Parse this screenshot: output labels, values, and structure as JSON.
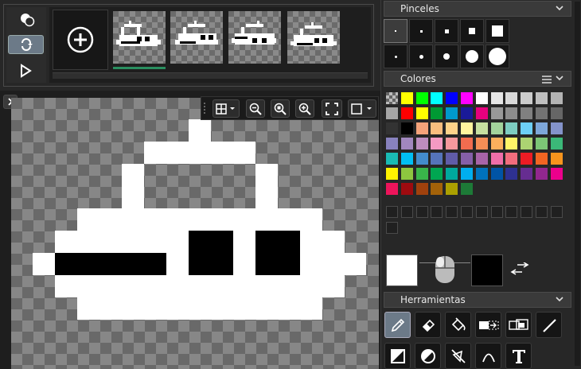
{
  "animation": {
    "add_frame_icon": "plus-circle-icon",
    "frames": [
      {
        "label": "frame-1",
        "selected": true
      },
      {
        "label": "frame-2",
        "selected": false
      },
      {
        "label": "frame-3",
        "selected": false
      },
      {
        "label": "frame-4",
        "selected": false
      }
    ]
  },
  "panels": {
    "brushes_title": "Pinceles",
    "colors_title": "Colores",
    "tools_title": "Herramientas"
  },
  "colors": {
    "primary": "#ffffff",
    "secondary": "#000000",
    "palette": [
      "#808080",
      "#ffff00",
      "#00ff00",
      "#00ffff",
      "#0000ff",
      "#ff00ff",
      "#ffffff",
      "#e6e6e6",
      "#d9d9d9",
      "#cccccc",
      "#bfbfbf",
      "#b3b3b3",
      "#a6a6a6",
      "#ff0000",
      "#ffff00",
      "#009933",
      "#0099cc",
      "#1a1a99",
      "#e6007e",
      "#999999",
      "#8c8c8c",
      "#808080",
      "#737373",
      "#666666",
      "#333333",
      "#000000",
      "#f5a37a",
      "#f9bd7e",
      "#fed38a",
      "#fff59e",
      "#c6e0a0",
      "#a3d39c",
      "#7ecdc2",
      "#6dcff6",
      "#7da7d9",
      "#8493ca",
      "#8882be",
      "#a187be",
      "#bc8dbf",
      "#f49ac2",
      "#f6989d",
      "#f26c4f",
      "#f68e56",
      "#fbaf5d",
      "#fff568",
      "#acd372",
      "#7cc576",
      "#3bb878",
      "#1abbb4",
      "#00bff3",
      "#438ccb",
      "#5574b9",
      "#605ca8",
      "#855fa8",
      "#a864a8",
      "#f06ea9",
      "#f26d7d",
      "#ed1c24",
      "#f26522",
      "#f7941d",
      "#fff200",
      "#8dc63f",
      "#39b54a",
      "#00a651",
      "#00a99d",
      "#00aeef",
      "#0072bc",
      "#0054a6",
      "#2e3192",
      "#662d91",
      "#92278f",
      "#ec008c",
      "#ed145b",
      "#9e0b0f",
      "#a0410d",
      "#a36209",
      "#aba000",
      "#1d7a37"
    ]
  },
  "canvas_toolbar": {
    "grid_icon": "grid-icon",
    "zoom_out_icon": "zoom-out-icon",
    "zoom_fit_icon": "zoom-fit-icon",
    "zoom_in_icon": "zoom-in-icon",
    "fullscreen_icon": "fullscreen-icon",
    "background_icon": "background-square-icon"
  },
  "tools": [
    "pencil-icon",
    "eraser-icon",
    "fill-bucket-icon",
    "select-rect-icon",
    "move-selection-icon",
    "line-icon",
    "rect-icon",
    "ellipse-icon",
    "lasso-icon",
    "curve-icon",
    "text-icon"
  ]
}
